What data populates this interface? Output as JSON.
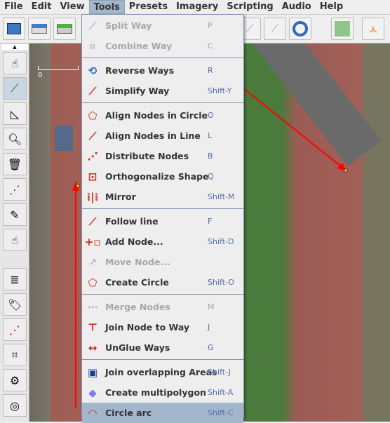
{
  "menubar": [
    {
      "label": "File",
      "active": false
    },
    {
      "label": "Edit",
      "active": false
    },
    {
      "label": "View",
      "active": false
    },
    {
      "label": "Tools",
      "active": true
    },
    {
      "label": "Presets",
      "active": false
    },
    {
      "label": "Imagery",
      "active": false
    },
    {
      "label": "Scripting",
      "active": false
    },
    {
      "label": "Audio",
      "active": false
    },
    {
      "label": "Help",
      "active": false
    }
  ],
  "map": {
    "scale_label": "0"
  },
  "tools_menu": {
    "groups": [
      [
        {
          "label": "Split Way",
          "shortcut": "P",
          "enabled": false,
          "icon": "split-way-icon"
        },
        {
          "label": "Combine Way",
          "shortcut": "C",
          "enabled": false,
          "icon": "combine-way-icon"
        }
      ],
      [
        {
          "label": "Reverse Ways",
          "shortcut": "R",
          "enabled": true,
          "icon": "reverse-ways-icon"
        },
        {
          "label": "Simplify Way",
          "shortcut": "Shift-Y",
          "enabled": true,
          "icon": "simplify-way-icon"
        }
      ],
      [
        {
          "label": "Align Nodes in Circle",
          "shortcut": "O",
          "enabled": true,
          "icon": "align-circle-icon"
        },
        {
          "label": "Align Nodes in Line",
          "shortcut": "L",
          "enabled": true,
          "icon": "align-line-icon"
        },
        {
          "label": "Distribute Nodes",
          "shortcut": "B",
          "enabled": true,
          "icon": "distribute-nodes-icon"
        },
        {
          "label": "Orthogonalize Shape",
          "shortcut": "Q",
          "enabled": true,
          "icon": "orthogonalize-icon"
        },
        {
          "label": "Mirror",
          "shortcut": "Shift-M",
          "enabled": true,
          "icon": "mirror-icon"
        }
      ],
      [
        {
          "label": "Follow line",
          "shortcut": "F",
          "enabled": true,
          "icon": "follow-line-icon"
        },
        {
          "label": "Add Node...",
          "shortcut": "Shift-D",
          "enabled": true,
          "icon": "add-node-icon"
        },
        {
          "label": "Move Node...",
          "shortcut": "",
          "enabled": false,
          "icon": "move-node-icon"
        },
        {
          "label": "Create Circle",
          "shortcut": "Shift-O",
          "enabled": true,
          "icon": "create-circle-icon"
        }
      ],
      [
        {
          "label": "Merge Nodes",
          "shortcut": "M",
          "enabled": false,
          "icon": "merge-nodes-icon"
        },
        {
          "label": "Join Node to Way",
          "shortcut": "J",
          "enabled": true,
          "icon": "join-node-way-icon"
        },
        {
          "label": "UnGlue Ways",
          "shortcut": "G",
          "enabled": true,
          "icon": "unglue-ways-icon"
        }
      ],
      [
        {
          "label": "Join overlapping Areas",
          "shortcut": "Shift-J",
          "enabled": true,
          "icon": "join-areas-icon"
        },
        {
          "label": "Create multipolygon",
          "shortcut": "Shift-A",
          "enabled": true,
          "icon": "multipolygon-icon"
        },
        {
          "label": "Circle arc",
          "shortcut": "Shift-C",
          "enabled": true,
          "highlighted": true,
          "icon": "circle-arc-icon"
        }
      ]
    ]
  },
  "colors": {
    "highlight": "#a3b7cc",
    "shortcut": "#5570a8",
    "way": "#ff0000",
    "node": "#ffcc00"
  }
}
